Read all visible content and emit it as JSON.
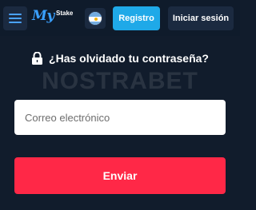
{
  "header": {
    "logo": {
      "script": "My",
      "word": "Stake"
    },
    "flag_icon": "argentina-flag-icon",
    "register_label": "Registro",
    "login_label": "Iniciar sesión"
  },
  "watermark": "NOSTRABET",
  "form": {
    "title": "¿Has olvidado tu contraseña?",
    "email_placeholder": "Correo electrónico",
    "email_value": "",
    "submit_label": "Enviar"
  },
  "colors": {
    "background": "#111c2c",
    "register_button": "#1fa9e8",
    "submit_button": "#ff2847",
    "accent_blue": "#3aa0ff"
  }
}
